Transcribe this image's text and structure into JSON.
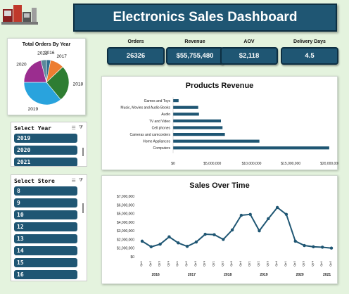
{
  "header": {
    "title": "Electronics Sales Dashboard",
    "logo_icon": "electronics-products-icon"
  },
  "kpis": [
    {
      "label": "Orders",
      "value": "26326"
    },
    {
      "label": "Revenue",
      "value": "$55,755,480"
    },
    {
      "label": "AOV",
      "value": "$2,118"
    },
    {
      "label": "Delivery Days",
      "value": "4.5"
    }
  ],
  "slicer_year": {
    "title": "Select Year",
    "items": [
      "2019",
      "2020",
      "2021"
    ]
  },
  "slicer_store": {
    "title": "Select Store",
    "items": [
      "8",
      "9",
      "10",
      "12",
      "13",
      "14",
      "15",
      "16"
    ]
  },
  "colors": {
    "accent": "#1f5673",
    "bar": "#1f5673",
    "background": "#e4f3de"
  },
  "chart_data": [
    {
      "type": "pie",
      "title": "Total Orders By Year",
      "categories": [
        "2016",
        "2017",
        "2018",
        "2019",
        "2020",
        "2021"
      ],
      "values": [
        3,
        10,
        26,
        36,
        21,
        4
      ],
      "colors": [
        "#2f6f8f",
        "#ed7d31",
        "#2e7d32",
        "#29a3dd",
        "#9b2d8f",
        "#5a8a9a"
      ],
      "legend": "labels-outside"
    },
    {
      "type": "bar",
      "orientation": "horizontal",
      "title": "Products Revenue",
      "categories": [
        "Games and Toys",
        "Music, Movies and Audio Books",
        "Audio",
        "TV and Video",
        "Cell phones",
        "Cameras and camcorders",
        "Home Appliances",
        "Computers"
      ],
      "values": [
        700000,
        3200000,
        3300000,
        6100000,
        6300000,
        6600000,
        11000000,
        19900000
      ],
      "tick_labels": [
        "$0",
        "$5,000,000",
        "$10,000,000",
        "$15,000,000",
        "$20,000,000"
      ],
      "xlim": [
        0,
        20000000
      ],
      "grid": false
    },
    {
      "type": "line",
      "title": "Sales Over Time",
      "x": [
        "Qtr1",
        "Qtr2",
        "Qtr3",
        "Qtr4",
        "Qtr1",
        "Qtr2",
        "Qtr3",
        "Qtr4",
        "Qtr1",
        "Qtr2",
        "Qtr3",
        "Qtr4",
        "Qtr1",
        "Qtr2",
        "Qtr3",
        "Qtr4",
        "Qtr1",
        "Qtr2",
        "Qtr3",
        "Qtr4",
        "Qtr1",
        "Qtr2"
      ],
      "years": [
        {
          "label": "2016",
          "count": 4
        },
        {
          "label": "2017",
          "count": 4
        },
        {
          "label": "2018",
          "count": 4
        },
        {
          "label": "2019",
          "count": 4
        },
        {
          "label": "2020",
          "count": 4
        },
        {
          "label": "2021",
          "count": 2
        }
      ],
      "values": [
        1800000,
        1150000,
        1450000,
        2300000,
        1600000,
        1200000,
        1700000,
        2600000,
        2550000,
        2000000,
        3100000,
        4800000,
        4900000,
        3000000,
        4400000,
        5700000,
        4900000,
        1800000,
        1300000,
        1150000,
        1100000,
        1000000
      ],
      "tick_labels": [
        "$0",
        "$1,000,000",
        "$2,000,000",
        "$3,000,000",
        "$4,000,000",
        "$5,000,000",
        "$6,000,000",
        "$7,000,000"
      ],
      "ylim": [
        0,
        7000000
      ],
      "grid": false
    }
  ]
}
